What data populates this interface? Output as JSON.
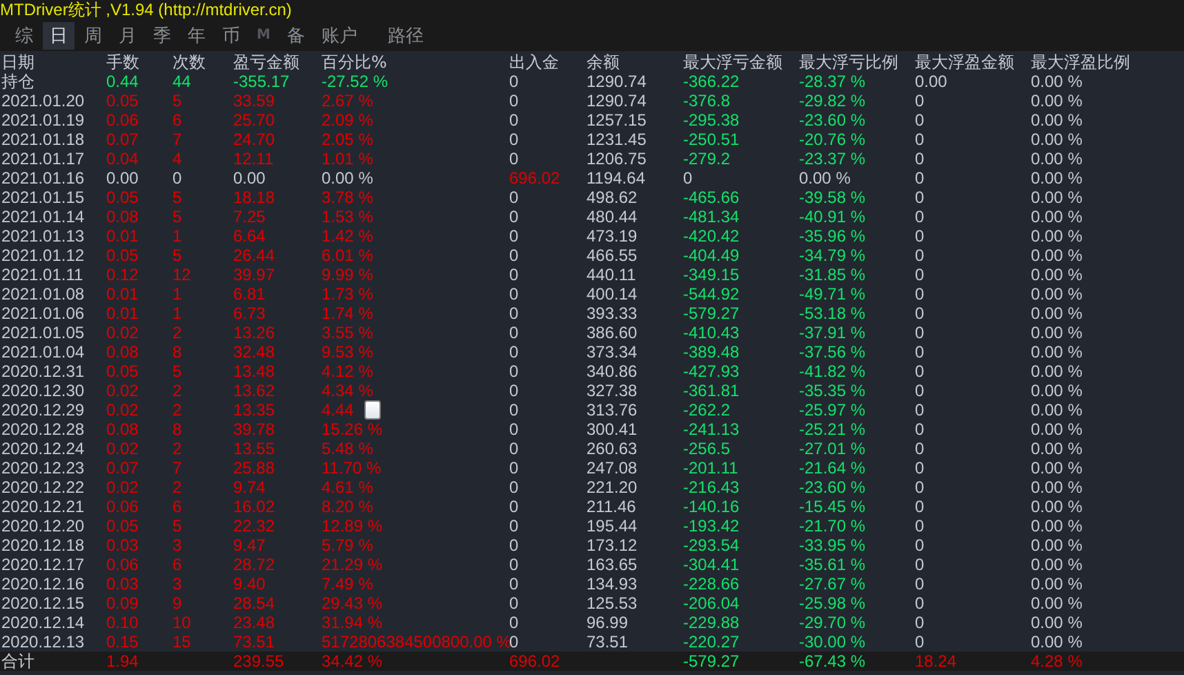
{
  "window": {
    "title": "MTDriver统计 ,V1.94 (http://mtdriver.cn)"
  },
  "tabs": [
    {
      "label": "综",
      "selected": false,
      "disabled": false
    },
    {
      "label": "日",
      "selected": true,
      "disabled": false
    },
    {
      "label": "周",
      "selected": false,
      "disabled": false
    },
    {
      "label": "月",
      "selected": false,
      "disabled": false
    },
    {
      "label": "季",
      "selected": false,
      "disabled": false
    },
    {
      "label": "年",
      "selected": false,
      "disabled": false
    },
    {
      "label": "币",
      "selected": false,
      "disabled": false
    },
    {
      "label": "M",
      "selected": false,
      "disabled": true
    },
    {
      "label": "备",
      "selected": false,
      "disabled": false
    },
    {
      "label": "账户",
      "selected": false,
      "disabled": false
    },
    {
      "label": "路径",
      "selected": false,
      "disabled": false
    }
  ],
  "table": {
    "columns": [
      "日期",
      "手数",
      "次数",
      "盈亏金额",
      "百分比%",
      "出入金",
      "余额",
      "最大浮亏金额",
      "最大浮亏比例",
      "最大浮盈金额",
      "最大浮盈比例"
    ],
    "rows": [
      [
        {
          "text": "持仓",
          "color": "#c5cad3"
        },
        {
          "text": "0.44",
          "color": "#13e26a"
        },
        {
          "text": "44",
          "color": "#13e26a"
        },
        {
          "text": "-355.17",
          "color": "#13e26a"
        },
        {
          "text": "-27.52 %",
          "color": "#13e26a"
        },
        {
          "text": "0",
          "color": "#c5cad3"
        },
        {
          "text": "1290.74",
          "color": "#c5cad3"
        },
        {
          "text": "-366.22",
          "color": "#13e26a"
        },
        {
          "text": "-28.37 %",
          "color": "#13e26a"
        },
        {
          "text": "0.00",
          "color": "#c5cad3"
        },
        {
          "text": "0.00 %",
          "color": "#c5cad3"
        }
      ],
      [
        {
          "text": "2021.01.20",
          "color": "#c5cad3"
        },
        {
          "text": "0.05",
          "color": "#e00000"
        },
        {
          "text": "5",
          "color": "#e00000"
        },
        {
          "text": "33.59",
          "color": "#e00000"
        },
        {
          "text": "2.67 %",
          "color": "#e00000"
        },
        {
          "text": "0",
          "color": "#c5cad3"
        },
        {
          "text": "1290.74",
          "color": "#c5cad3"
        },
        {
          "text": "-376.8",
          "color": "#13e26a"
        },
        {
          "text": "-29.82 %",
          "color": "#13e26a"
        },
        {
          "text": "0",
          "color": "#c5cad3"
        },
        {
          "text": "0.00 %",
          "color": "#c5cad3"
        }
      ],
      [
        {
          "text": "2021.01.19",
          "color": "#c5cad3"
        },
        {
          "text": "0.06",
          "color": "#e00000"
        },
        {
          "text": "6",
          "color": "#e00000"
        },
        {
          "text": "25.70",
          "color": "#e00000"
        },
        {
          "text": "2.09 %",
          "color": "#e00000"
        },
        {
          "text": "0",
          "color": "#c5cad3"
        },
        {
          "text": "1257.15",
          "color": "#c5cad3"
        },
        {
          "text": "-295.38",
          "color": "#13e26a"
        },
        {
          "text": "-23.60 %",
          "color": "#13e26a"
        },
        {
          "text": "0",
          "color": "#c5cad3"
        },
        {
          "text": "0.00 %",
          "color": "#c5cad3"
        }
      ],
      [
        {
          "text": "2021.01.18",
          "color": "#c5cad3"
        },
        {
          "text": "0.07",
          "color": "#e00000"
        },
        {
          "text": "7",
          "color": "#e00000"
        },
        {
          "text": "24.70",
          "color": "#e00000"
        },
        {
          "text": "2.05 %",
          "color": "#e00000"
        },
        {
          "text": "0",
          "color": "#c5cad3"
        },
        {
          "text": "1231.45",
          "color": "#c5cad3"
        },
        {
          "text": "-250.51",
          "color": "#13e26a"
        },
        {
          "text": "-20.76 %",
          "color": "#13e26a"
        },
        {
          "text": "0",
          "color": "#c5cad3"
        },
        {
          "text": "0.00 %",
          "color": "#c5cad3"
        }
      ],
      [
        {
          "text": "2021.01.17",
          "color": "#c5cad3"
        },
        {
          "text": "0.04",
          "color": "#e00000"
        },
        {
          "text": "4",
          "color": "#e00000"
        },
        {
          "text": "12.11",
          "color": "#e00000"
        },
        {
          "text": "1.01 %",
          "color": "#e00000"
        },
        {
          "text": "0",
          "color": "#c5cad3"
        },
        {
          "text": "1206.75",
          "color": "#c5cad3"
        },
        {
          "text": "-279.2",
          "color": "#13e26a"
        },
        {
          "text": "-23.37 %",
          "color": "#13e26a"
        },
        {
          "text": "0",
          "color": "#c5cad3"
        },
        {
          "text": "0.00 %",
          "color": "#c5cad3"
        }
      ],
      [
        {
          "text": "2021.01.16",
          "color": "#c5cad3"
        },
        {
          "text": "0.00",
          "color": "#c5cad3"
        },
        {
          "text": "0",
          "color": "#c5cad3"
        },
        {
          "text": "0.00",
          "color": "#c5cad3"
        },
        {
          "text": "0.00 %",
          "color": "#c5cad3"
        },
        {
          "text": "696.02",
          "color": "#e00000"
        },
        {
          "text": "1194.64",
          "color": "#c5cad3"
        },
        {
          "text": "0",
          "color": "#c5cad3"
        },
        {
          "text": "0.00 %",
          "color": "#c5cad3"
        },
        {
          "text": "0",
          "color": "#c5cad3"
        },
        {
          "text": "0.00 %",
          "color": "#c5cad3"
        }
      ],
      [
        {
          "text": "2021.01.15",
          "color": "#c5cad3"
        },
        {
          "text": "0.05",
          "color": "#e00000"
        },
        {
          "text": "5",
          "color": "#e00000"
        },
        {
          "text": "18.18",
          "color": "#e00000"
        },
        {
          "text": "3.78 %",
          "color": "#e00000"
        },
        {
          "text": "0",
          "color": "#c5cad3"
        },
        {
          "text": "498.62",
          "color": "#c5cad3"
        },
        {
          "text": "-465.66",
          "color": "#13e26a"
        },
        {
          "text": "-39.58 %",
          "color": "#13e26a"
        },
        {
          "text": "0",
          "color": "#c5cad3"
        },
        {
          "text": "0.00 %",
          "color": "#c5cad3"
        }
      ],
      [
        {
          "text": "2021.01.14",
          "color": "#c5cad3"
        },
        {
          "text": "0.08",
          "color": "#e00000"
        },
        {
          "text": "5",
          "color": "#e00000"
        },
        {
          "text": "7.25",
          "color": "#e00000"
        },
        {
          "text": "1.53 %",
          "color": "#e00000"
        },
        {
          "text": "0",
          "color": "#c5cad3"
        },
        {
          "text": "480.44",
          "color": "#c5cad3"
        },
        {
          "text": "-481.34",
          "color": "#13e26a"
        },
        {
          "text": "-40.91 %",
          "color": "#13e26a"
        },
        {
          "text": "0",
          "color": "#c5cad3"
        },
        {
          "text": "0.00 %",
          "color": "#c5cad3"
        }
      ],
      [
        {
          "text": "2021.01.13",
          "color": "#c5cad3"
        },
        {
          "text": "0.01",
          "color": "#e00000"
        },
        {
          "text": "1",
          "color": "#e00000"
        },
        {
          "text": "6.64",
          "color": "#e00000"
        },
        {
          "text": "1.42 %",
          "color": "#e00000"
        },
        {
          "text": "0",
          "color": "#c5cad3"
        },
        {
          "text": "473.19",
          "color": "#c5cad3"
        },
        {
          "text": "-420.42",
          "color": "#13e26a"
        },
        {
          "text": "-35.96 %",
          "color": "#13e26a"
        },
        {
          "text": "0",
          "color": "#c5cad3"
        },
        {
          "text": "0.00 %",
          "color": "#c5cad3"
        }
      ],
      [
        {
          "text": "2021.01.12",
          "color": "#c5cad3"
        },
        {
          "text": "0.05",
          "color": "#e00000"
        },
        {
          "text": "5",
          "color": "#e00000"
        },
        {
          "text": "26.44",
          "color": "#e00000"
        },
        {
          "text": "6.01 %",
          "color": "#e00000"
        },
        {
          "text": "0",
          "color": "#c5cad3"
        },
        {
          "text": "466.55",
          "color": "#c5cad3"
        },
        {
          "text": "-404.49",
          "color": "#13e26a"
        },
        {
          "text": "-34.79 %",
          "color": "#13e26a"
        },
        {
          "text": "0",
          "color": "#c5cad3"
        },
        {
          "text": "0.00 %",
          "color": "#c5cad3"
        }
      ],
      [
        {
          "text": "2021.01.11",
          "color": "#c5cad3"
        },
        {
          "text": "0.12",
          "color": "#e00000"
        },
        {
          "text": "12",
          "color": "#e00000"
        },
        {
          "text": "39.97",
          "color": "#e00000"
        },
        {
          "text": "9.99 %",
          "color": "#e00000"
        },
        {
          "text": "0",
          "color": "#c5cad3"
        },
        {
          "text": "440.11",
          "color": "#c5cad3"
        },
        {
          "text": "-349.15",
          "color": "#13e26a"
        },
        {
          "text": "-31.85 %",
          "color": "#13e26a"
        },
        {
          "text": "0",
          "color": "#c5cad3"
        },
        {
          "text": "0.00 %",
          "color": "#c5cad3"
        }
      ],
      [
        {
          "text": "2021.01.08",
          "color": "#c5cad3"
        },
        {
          "text": "0.01",
          "color": "#e00000"
        },
        {
          "text": "1",
          "color": "#e00000"
        },
        {
          "text": "6.81",
          "color": "#e00000"
        },
        {
          "text": "1.73 %",
          "color": "#e00000"
        },
        {
          "text": "0",
          "color": "#c5cad3"
        },
        {
          "text": "400.14",
          "color": "#c5cad3"
        },
        {
          "text": "-544.92",
          "color": "#13e26a"
        },
        {
          "text": "-49.71 %",
          "color": "#13e26a"
        },
        {
          "text": "0",
          "color": "#c5cad3"
        },
        {
          "text": "0.00 %",
          "color": "#c5cad3"
        }
      ],
      [
        {
          "text": "2021.01.06",
          "color": "#c5cad3"
        },
        {
          "text": "0.01",
          "color": "#e00000"
        },
        {
          "text": "1",
          "color": "#e00000"
        },
        {
          "text": "6.73",
          "color": "#e00000"
        },
        {
          "text": "1.74 %",
          "color": "#e00000"
        },
        {
          "text": "0",
          "color": "#c5cad3"
        },
        {
          "text": "393.33",
          "color": "#c5cad3"
        },
        {
          "text": "-579.27",
          "color": "#13e26a"
        },
        {
          "text": "-53.18 %",
          "color": "#13e26a"
        },
        {
          "text": "0",
          "color": "#c5cad3"
        },
        {
          "text": "0.00 %",
          "color": "#c5cad3"
        }
      ],
      [
        {
          "text": "2021.01.05",
          "color": "#c5cad3"
        },
        {
          "text": "0.02",
          "color": "#e00000"
        },
        {
          "text": "2",
          "color": "#e00000"
        },
        {
          "text": "13.26",
          "color": "#e00000"
        },
        {
          "text": "3.55 %",
          "color": "#e00000"
        },
        {
          "text": "0",
          "color": "#c5cad3"
        },
        {
          "text": "386.60",
          "color": "#c5cad3"
        },
        {
          "text": "-410.43",
          "color": "#13e26a"
        },
        {
          "text": "-37.91 %",
          "color": "#13e26a"
        },
        {
          "text": "0",
          "color": "#c5cad3"
        },
        {
          "text": "0.00 %",
          "color": "#c5cad3"
        }
      ],
      [
        {
          "text": "2021.01.04",
          "color": "#c5cad3"
        },
        {
          "text": "0.08",
          "color": "#e00000"
        },
        {
          "text": "8",
          "color": "#e00000"
        },
        {
          "text": "32.48",
          "color": "#e00000"
        },
        {
          "text": "9.53 %",
          "color": "#e00000"
        },
        {
          "text": "0",
          "color": "#c5cad3"
        },
        {
          "text": "373.34",
          "color": "#c5cad3"
        },
        {
          "text": "-389.48",
          "color": "#13e26a"
        },
        {
          "text": "-37.56 %",
          "color": "#13e26a"
        },
        {
          "text": "0",
          "color": "#c5cad3"
        },
        {
          "text": "0.00 %",
          "color": "#c5cad3"
        }
      ],
      [
        {
          "text": "2020.12.31",
          "color": "#c5cad3"
        },
        {
          "text": "0.05",
          "color": "#e00000"
        },
        {
          "text": "5",
          "color": "#e00000"
        },
        {
          "text": "13.48",
          "color": "#e00000"
        },
        {
          "text": "4.12 %",
          "color": "#e00000"
        },
        {
          "text": "0",
          "color": "#c5cad3"
        },
        {
          "text": "340.86",
          "color": "#c5cad3"
        },
        {
          "text": "-427.93",
          "color": "#13e26a"
        },
        {
          "text": "-41.82 %",
          "color": "#13e26a"
        },
        {
          "text": "0",
          "color": "#c5cad3"
        },
        {
          "text": "0.00 %",
          "color": "#c5cad3"
        }
      ],
      [
        {
          "text": "2020.12.30",
          "color": "#c5cad3"
        },
        {
          "text": "0.02",
          "color": "#e00000"
        },
        {
          "text": "2",
          "color": "#e00000"
        },
        {
          "text": "13.62",
          "color": "#e00000"
        },
        {
          "text": "4.34 %",
          "color": "#e00000"
        },
        {
          "text": "0",
          "color": "#c5cad3"
        },
        {
          "text": "327.38",
          "color": "#c5cad3"
        },
        {
          "text": "-361.81",
          "color": "#13e26a"
        },
        {
          "text": "-35.35 %",
          "color": "#13e26a"
        },
        {
          "text": "0",
          "color": "#c5cad3"
        },
        {
          "text": "0.00 %",
          "color": "#c5cad3"
        }
      ],
      [
        {
          "text": "2020.12.29",
          "color": "#c5cad3"
        },
        {
          "text": "0.02",
          "color": "#e00000"
        },
        {
          "text": "2",
          "color": "#e00000"
        },
        {
          "text": "13.35",
          "color": "#e00000"
        },
        {
          "text": "4.44",
          "color": "#e00000"
        },
        {
          "text": "0",
          "color": "#c5cad3"
        },
        {
          "text": "313.76",
          "color": "#c5cad3"
        },
        {
          "text": "-262.2",
          "color": "#13e26a"
        },
        {
          "text": "-25.97 %",
          "color": "#13e26a"
        },
        {
          "text": "0",
          "color": "#c5cad3"
        },
        {
          "text": "0.00 %",
          "color": "#c5cad3"
        }
      ],
      [
        {
          "text": "2020.12.28",
          "color": "#c5cad3"
        },
        {
          "text": "0.08",
          "color": "#e00000"
        },
        {
          "text": "8",
          "color": "#e00000"
        },
        {
          "text": "39.78",
          "color": "#e00000"
        },
        {
          "text": "15.26 %",
          "color": "#e00000"
        },
        {
          "text": "0",
          "color": "#c5cad3"
        },
        {
          "text": "300.41",
          "color": "#c5cad3"
        },
        {
          "text": "-241.13",
          "color": "#13e26a"
        },
        {
          "text": "-25.21 %",
          "color": "#13e26a"
        },
        {
          "text": "0",
          "color": "#c5cad3"
        },
        {
          "text": "0.00 %",
          "color": "#c5cad3"
        }
      ],
      [
        {
          "text": "2020.12.24",
          "color": "#c5cad3"
        },
        {
          "text": "0.02",
          "color": "#e00000"
        },
        {
          "text": "2",
          "color": "#e00000"
        },
        {
          "text": "13.55",
          "color": "#e00000"
        },
        {
          "text": "5.48 %",
          "color": "#e00000"
        },
        {
          "text": "0",
          "color": "#c5cad3"
        },
        {
          "text": "260.63",
          "color": "#c5cad3"
        },
        {
          "text": "-256.5",
          "color": "#13e26a"
        },
        {
          "text": "-27.01 %",
          "color": "#13e26a"
        },
        {
          "text": "0",
          "color": "#c5cad3"
        },
        {
          "text": "0.00 %",
          "color": "#c5cad3"
        }
      ],
      [
        {
          "text": "2020.12.23",
          "color": "#c5cad3"
        },
        {
          "text": "0.07",
          "color": "#e00000"
        },
        {
          "text": "7",
          "color": "#e00000"
        },
        {
          "text": "25.88",
          "color": "#e00000"
        },
        {
          "text": "11.70 %",
          "color": "#e00000"
        },
        {
          "text": "0",
          "color": "#c5cad3"
        },
        {
          "text": "247.08",
          "color": "#c5cad3"
        },
        {
          "text": "-201.11",
          "color": "#13e26a"
        },
        {
          "text": "-21.64 %",
          "color": "#13e26a"
        },
        {
          "text": "0",
          "color": "#c5cad3"
        },
        {
          "text": "0.00 %",
          "color": "#c5cad3"
        }
      ],
      [
        {
          "text": "2020.12.22",
          "color": "#c5cad3"
        },
        {
          "text": "0.02",
          "color": "#e00000"
        },
        {
          "text": "2",
          "color": "#e00000"
        },
        {
          "text": "9.74",
          "color": "#e00000"
        },
        {
          "text": "4.61 %",
          "color": "#e00000"
        },
        {
          "text": "0",
          "color": "#c5cad3"
        },
        {
          "text": "221.20",
          "color": "#c5cad3"
        },
        {
          "text": "-216.43",
          "color": "#13e26a"
        },
        {
          "text": "-23.60 %",
          "color": "#13e26a"
        },
        {
          "text": "0",
          "color": "#c5cad3"
        },
        {
          "text": "0.00 %",
          "color": "#c5cad3"
        }
      ],
      [
        {
          "text": "2020.12.21",
          "color": "#c5cad3"
        },
        {
          "text": "0.06",
          "color": "#e00000"
        },
        {
          "text": "6",
          "color": "#e00000"
        },
        {
          "text": "16.02",
          "color": "#e00000"
        },
        {
          "text": "8.20 %",
          "color": "#e00000"
        },
        {
          "text": "0",
          "color": "#c5cad3"
        },
        {
          "text": "211.46",
          "color": "#c5cad3"
        },
        {
          "text": "-140.16",
          "color": "#13e26a"
        },
        {
          "text": "-15.45 %",
          "color": "#13e26a"
        },
        {
          "text": "0",
          "color": "#c5cad3"
        },
        {
          "text": "0.00 %",
          "color": "#c5cad3"
        }
      ],
      [
        {
          "text": "2020.12.20",
          "color": "#c5cad3"
        },
        {
          "text": "0.05",
          "color": "#e00000"
        },
        {
          "text": "5",
          "color": "#e00000"
        },
        {
          "text": "22.32",
          "color": "#e00000"
        },
        {
          "text": "12.89 %",
          "color": "#e00000"
        },
        {
          "text": "0",
          "color": "#c5cad3"
        },
        {
          "text": "195.44",
          "color": "#c5cad3"
        },
        {
          "text": "-193.42",
          "color": "#13e26a"
        },
        {
          "text": "-21.70 %",
          "color": "#13e26a"
        },
        {
          "text": "0",
          "color": "#c5cad3"
        },
        {
          "text": "0.00 %",
          "color": "#c5cad3"
        }
      ],
      [
        {
          "text": "2020.12.18",
          "color": "#c5cad3"
        },
        {
          "text": "0.03",
          "color": "#e00000"
        },
        {
          "text": "3",
          "color": "#e00000"
        },
        {
          "text": "9.47",
          "color": "#e00000"
        },
        {
          "text": "5.79 %",
          "color": "#e00000"
        },
        {
          "text": "0",
          "color": "#c5cad3"
        },
        {
          "text": "173.12",
          "color": "#c5cad3"
        },
        {
          "text": "-293.54",
          "color": "#13e26a"
        },
        {
          "text": "-33.95 %",
          "color": "#13e26a"
        },
        {
          "text": "0",
          "color": "#c5cad3"
        },
        {
          "text": "0.00 %",
          "color": "#c5cad3"
        }
      ],
      [
        {
          "text": "2020.12.17",
          "color": "#c5cad3"
        },
        {
          "text": "0.06",
          "color": "#e00000"
        },
        {
          "text": "6",
          "color": "#e00000"
        },
        {
          "text": "28.72",
          "color": "#e00000"
        },
        {
          "text": "21.29 %",
          "color": "#e00000"
        },
        {
          "text": "0",
          "color": "#c5cad3"
        },
        {
          "text": "163.65",
          "color": "#c5cad3"
        },
        {
          "text": "-304.41",
          "color": "#13e26a"
        },
        {
          "text": "-35.61 %",
          "color": "#13e26a"
        },
        {
          "text": "0",
          "color": "#c5cad3"
        },
        {
          "text": "0.00 %",
          "color": "#c5cad3"
        }
      ],
      [
        {
          "text": "2020.12.16",
          "color": "#c5cad3"
        },
        {
          "text": "0.03",
          "color": "#e00000"
        },
        {
          "text": "3",
          "color": "#e00000"
        },
        {
          "text": "9.40",
          "color": "#e00000"
        },
        {
          "text": "7.49 %",
          "color": "#e00000"
        },
        {
          "text": "0",
          "color": "#c5cad3"
        },
        {
          "text": "134.93",
          "color": "#c5cad3"
        },
        {
          "text": "-228.66",
          "color": "#13e26a"
        },
        {
          "text": "-27.67 %",
          "color": "#13e26a"
        },
        {
          "text": "0",
          "color": "#c5cad3"
        },
        {
          "text": "0.00 %",
          "color": "#c5cad3"
        }
      ],
      [
        {
          "text": "2020.12.15",
          "color": "#c5cad3"
        },
        {
          "text": "0.09",
          "color": "#e00000"
        },
        {
          "text": "9",
          "color": "#e00000"
        },
        {
          "text": "28.54",
          "color": "#e00000"
        },
        {
          "text": "29.43 %",
          "color": "#e00000"
        },
        {
          "text": "0",
          "color": "#c5cad3"
        },
        {
          "text": "125.53",
          "color": "#c5cad3"
        },
        {
          "text": "-206.04",
          "color": "#13e26a"
        },
        {
          "text": "-25.98 %",
          "color": "#13e26a"
        },
        {
          "text": "0",
          "color": "#c5cad3"
        },
        {
          "text": "0.00 %",
          "color": "#c5cad3"
        }
      ],
      [
        {
          "text": "2020.12.14",
          "color": "#c5cad3"
        },
        {
          "text": "0.10",
          "color": "#e00000"
        },
        {
          "text": "10",
          "color": "#e00000"
        },
        {
          "text": "23.48",
          "color": "#e00000"
        },
        {
          "text": "31.94 %",
          "color": "#e00000"
        },
        {
          "text": "0",
          "color": "#c5cad3"
        },
        {
          "text": "96.99",
          "color": "#c5cad3"
        },
        {
          "text": "-229.88",
          "color": "#13e26a"
        },
        {
          "text": "-29.70 %",
          "color": "#13e26a"
        },
        {
          "text": "0",
          "color": "#c5cad3"
        },
        {
          "text": "0.00 %",
          "color": "#c5cad3"
        }
      ],
      [
        {
          "text": "2020.12.13",
          "color": "#c5cad3"
        },
        {
          "text": "0.15",
          "color": "#e00000"
        },
        {
          "text": "15",
          "color": "#e00000"
        },
        {
          "text": "73.51",
          "color": "#e00000"
        },
        {
          "text": "5172806384500800.00 %",
          "color": "#e00000"
        },
        {
          "text": "0",
          "color": "#c5cad3"
        },
        {
          "text": "73.51",
          "color": "#c5cad3"
        },
        {
          "text": "-220.27",
          "color": "#13e26a"
        },
        {
          "text": "-30.00 %",
          "color": "#13e26a"
        },
        {
          "text": "0",
          "color": "#c5cad3"
        },
        {
          "text": "0.00 %",
          "color": "#c5cad3"
        }
      ]
    ],
    "total": {
      "label": {
        "text": "合计",
        "color": "#c5cad3"
      },
      "lots": {
        "text": "1.94",
        "color": "#e00000"
      },
      "profit": {
        "text": "239.55",
        "color": "#e00000"
      },
      "percent": {
        "text": "34.42 %",
        "color": "#e00000"
      },
      "deposit": {
        "text": "696.02",
        "color": "#e00000"
      },
      "max_loss": {
        "text": "-579.27",
        "color": "#13e26a"
      },
      "max_loss_ratio": {
        "text": "-67.43 %",
        "color": "#13e26a"
      },
      "max_gain": {
        "text": "18.24",
        "color": "#e00000"
      },
      "max_gain_ratio": {
        "text": "4.28 %",
        "color": "#e00000"
      }
    }
  }
}
